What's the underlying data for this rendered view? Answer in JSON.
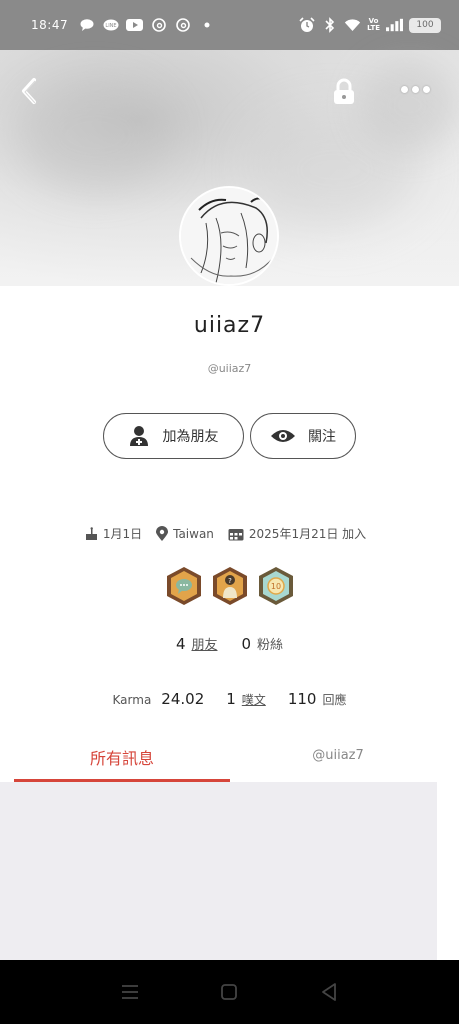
{
  "status_bar": {
    "time": "18:47",
    "battery": "100",
    "volte_top": "Vo",
    "volte_bottom": "LTE"
  },
  "profile": {
    "display_name": "uiiaz7",
    "handle": "@uiiaz7",
    "add_friend_label": "加為朋友",
    "follow_label": "關注",
    "birthday": "1月1日",
    "location": "Taiwan",
    "joined": "2025年1月21日 加入",
    "friends_count": "4",
    "friends_label": "朋友",
    "fans_count": "0",
    "fans_label": "粉絲",
    "karma_label": "Karma",
    "karma_value": "24.02",
    "posts_count": "1",
    "posts_label": "噗文",
    "replies_count": "110",
    "replies_label": "回應"
  },
  "tabs": {
    "all_messages": "所有訊息",
    "user_tab": "@uiiaz7"
  },
  "badges": [
    {
      "icon": "chat-badge-icon",
      "color": "#7a4a2a",
      "text": "..."
    },
    {
      "icon": "question-badge-icon",
      "color": "#7a4a2a",
      "text": "?"
    },
    {
      "icon": "ten-badge-icon",
      "color": "#6a5a3a",
      "text": "10"
    }
  ],
  "colors": {
    "accent": "#d6453a",
    "status_bar": "#8a8a8a",
    "content_bg": "#eeedf1"
  }
}
